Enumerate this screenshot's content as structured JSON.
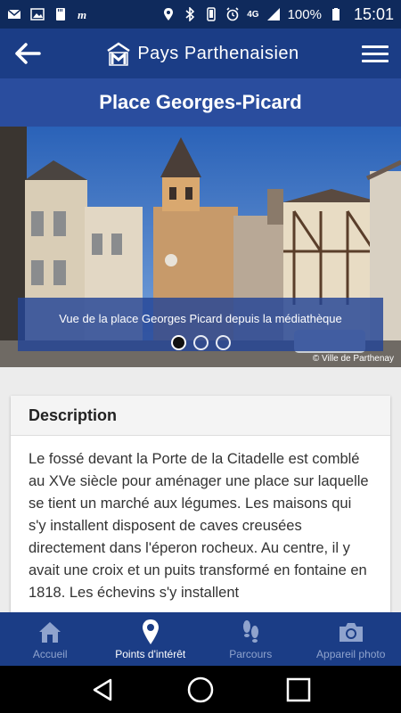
{
  "status": {
    "battery": "100%",
    "time": "15:01",
    "network": "4G"
  },
  "app": {
    "title": "Pays Parthenaisien"
  },
  "page": {
    "title": "Place Georges-Picard"
  },
  "gallery": {
    "caption": "Vue de la place Georges Picard depuis la médiathèque",
    "credit": "© Ville de Parthenay",
    "current": 1,
    "count": 3
  },
  "description": {
    "heading": "Description",
    "text": "Le fossé devant la Porte de la Citadelle est comblé au XVe siècle pour aménager une place sur laquelle se tient un marché aux légumes. Les maisons qui  s'y installent disposent de caves creusées directement dans l'éperon rocheux. Au centre, il y avait une croix et un puits transformé en fontaine en 1818. Les échevins s'y installent"
  },
  "nav": {
    "items": [
      {
        "label": "Accueil",
        "icon": "home-icon"
      },
      {
        "label": "Points d'intérêt",
        "icon": "map-pin-icon"
      },
      {
        "label": "Parcours",
        "icon": "footsteps-icon"
      },
      {
        "label": "Appareil photo",
        "icon": "camera-icon"
      }
    ],
    "active": 1
  },
  "colors": {
    "primary": "#1b3d86",
    "title_bar": "#2a4d9e",
    "status_bar": "#0f2a5c"
  }
}
